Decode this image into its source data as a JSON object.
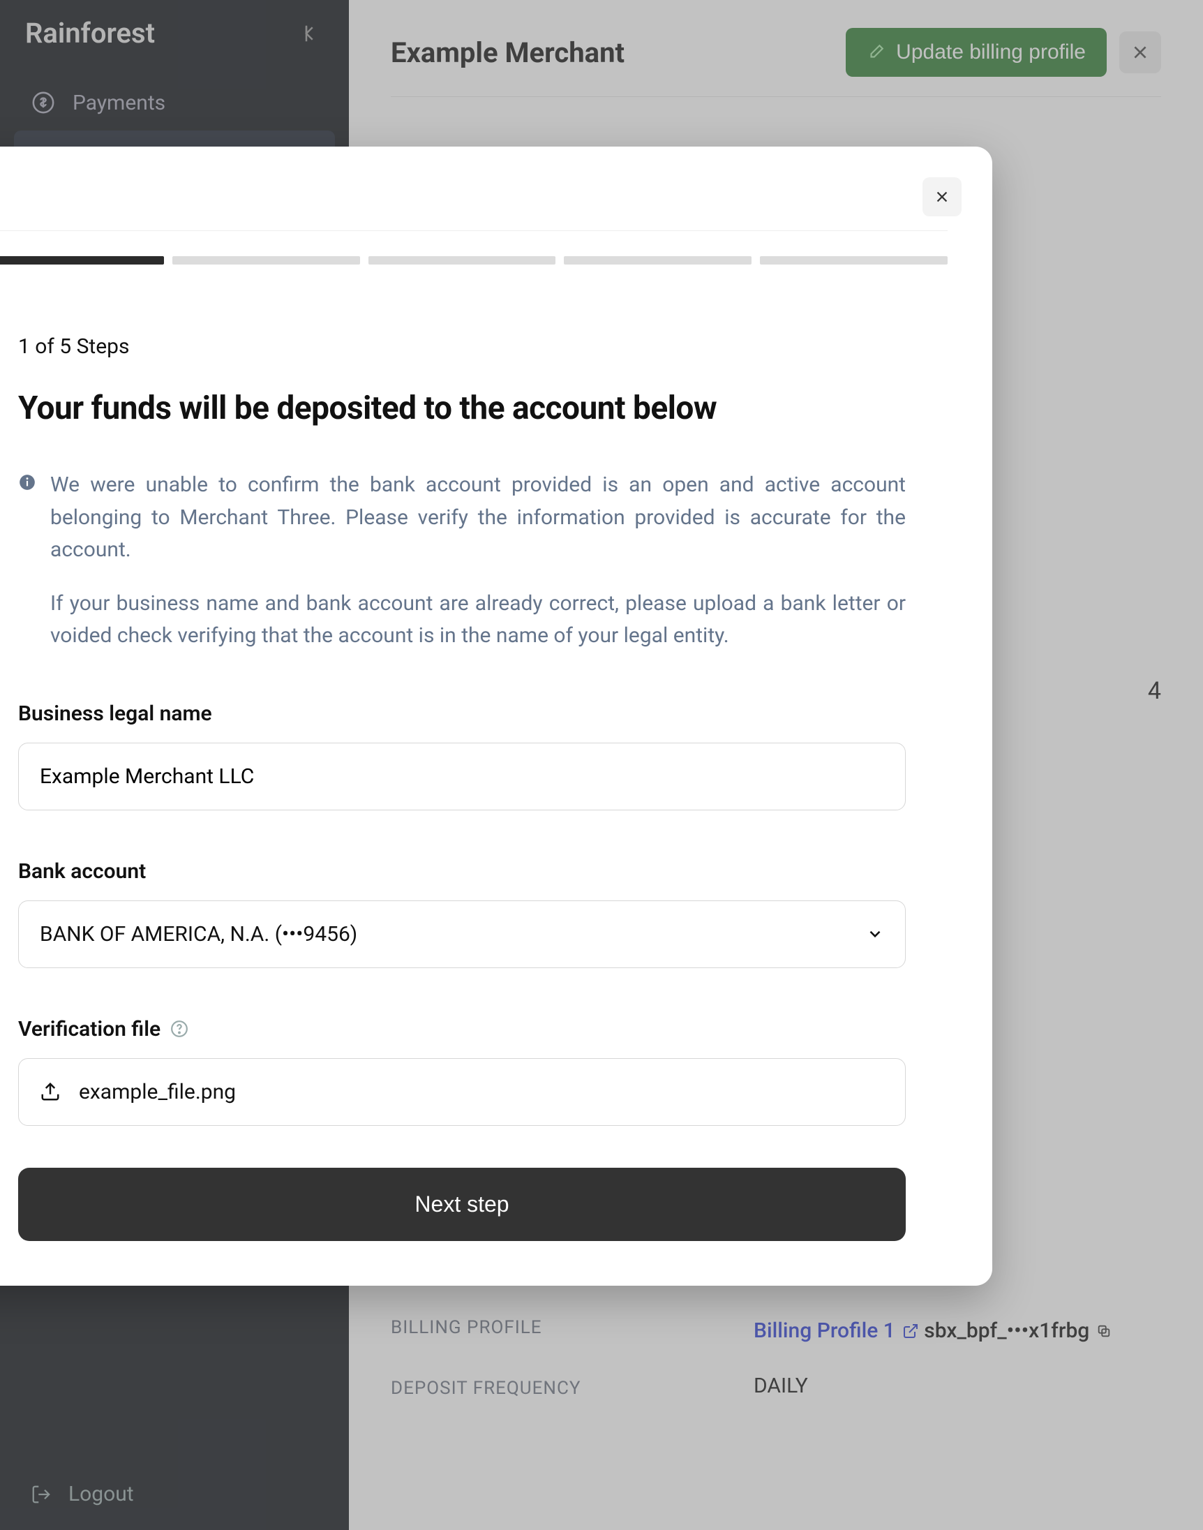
{
  "brand": "Rainforest",
  "sidebar": {
    "items": [
      {
        "label": "Payments"
      }
    ],
    "logout": "Logout"
  },
  "header": {
    "title": "Example Merchant",
    "update_button": "Update billing profile"
  },
  "details": {
    "billing_profile_label": "BILLING PROFILE",
    "billing_profile_name": "Billing Profile 1",
    "billing_profile_id": "sbx_bpf_•••x1frbg",
    "deposit_frequency_label": "DEPOSIT FREQUENCY",
    "deposit_frequency_value": "DAILY",
    "trailing_number": "4"
  },
  "modal": {
    "step_count": "1 of 5 Steps",
    "title": "Your funds will be deposited to the account below",
    "alert_p1": "We were unable to confirm the bank account provided is an open and active account belonging to Merchant Three. Please verify the information provided is accurate for the account.",
    "alert_p2": "If your business name and bank account are already correct, please upload a bank letter or voided check verifying that the account is in the name of your legal entity.",
    "fields": {
      "legal_name_label": "Business legal name",
      "legal_name_value": "Example Merchant LLC",
      "bank_label": "Bank account",
      "bank_value": "BANK OF AMERICA, N.A. (•••9456)",
      "verification_label": "Verification file",
      "verification_file": "example_file.png"
    },
    "next_button": "Next step"
  }
}
